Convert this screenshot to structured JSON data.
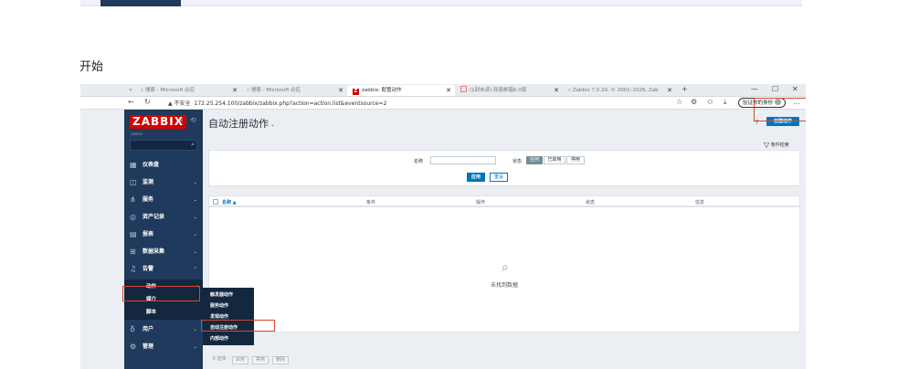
{
  "step_label": "开始",
  "browser": {
    "tabs": [
      {
        "label": "搜索 - Microsoft 必应",
        "active": false
      },
      {
        "label": "搜索 - Microsoft 必应",
        "active": false
      },
      {
        "label": "zabbix: 配置动作",
        "active": true,
        "favicon": "Z"
      },
      {
        "label": "(1封未读) 网易邮箱6.0版",
        "active": false
      },
      {
        "label": "Zabbix 7.0.29. © 2001–2026, Zab",
        "active": false
      }
    ],
    "new_tab": "+",
    "window_controls": [
      "—",
      "☐",
      "✕"
    ],
    "url_warning": "▲ 不安全",
    "url": "172.25.254.100/zabbix/zabbix.php?action=action.list&eventsource=2",
    "profile_label": "验证你的身份"
  },
  "sidebar": {
    "logo": "ZABBIX",
    "subtitle": "zabbix",
    "items": [
      {
        "label": "仪表盘",
        "icon": "dashboard-icon"
      },
      {
        "label": "监测",
        "icon": "monitoring-icon"
      },
      {
        "label": "服务",
        "icon": "services-icon"
      },
      {
        "label": "资产记录",
        "icon": "inventory-icon"
      },
      {
        "label": "报表",
        "icon": "reports-icon"
      },
      {
        "label": "数据采集",
        "icon": "data-collection-icon"
      },
      {
        "label": "告警",
        "icon": "bell-icon"
      }
    ],
    "alerts_submenu": [
      "动作",
      "媒介",
      "脚本"
    ],
    "bottom_items": [
      {
        "label": "用户",
        "icon": "user-icon"
      },
      {
        "label": "管理",
        "icon": "admin-icon"
      }
    ]
  },
  "flyout": [
    "触发器动作",
    "服务动作",
    "发现动作",
    "自动注册动作",
    "内部动作"
  ],
  "main": {
    "title": "自动注册动作",
    "create_button": "创建动作",
    "help": "?",
    "filter_tab": "条件检索",
    "filter": {
      "name_label": "名称",
      "status_label": "状态",
      "status_options": [
        "任何",
        "已启用",
        "停用"
      ],
      "status_selected": "任何",
      "apply": "应用",
      "reset": "重设"
    },
    "columns": [
      "名称 ▲",
      "条件",
      "操作",
      "状态",
      "信息"
    ],
    "empty_text": "未找到数据",
    "footer_buttons": [
      "0 选择",
      "启用",
      "禁用",
      "删除"
    ]
  }
}
